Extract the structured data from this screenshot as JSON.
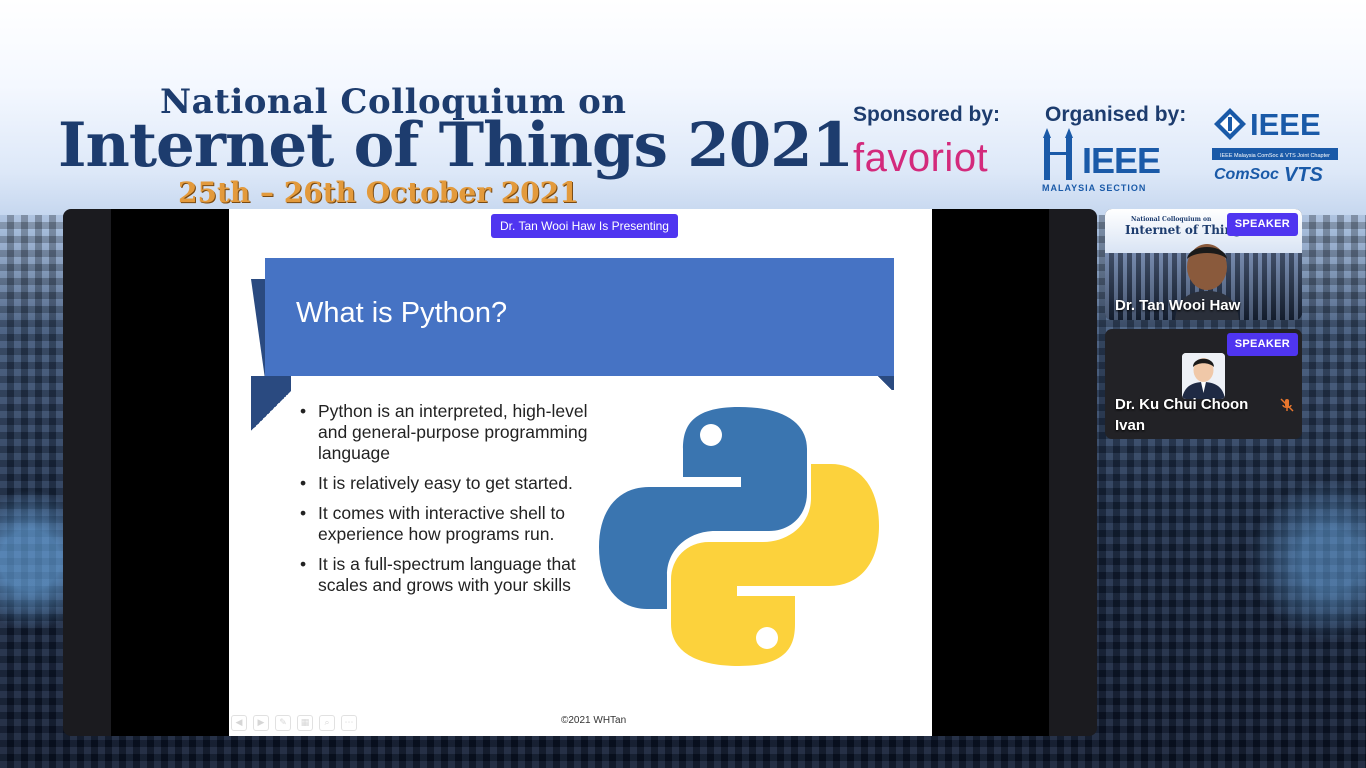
{
  "banner": {
    "title_line1": "National Colloquium on",
    "title_line2": "Internet of Things 2021",
    "dates": "25th – 26th October 2021",
    "sponsored_label": "Sponsored by:",
    "sponsor_logo_text": "favoriot",
    "organised_label": "Organised by:",
    "ieee_malaysia_text": "IEEE",
    "ieee_malaysia_sub": "MALAYSIA SECTION",
    "ieee_text": "IEEE",
    "ieee_chapter": "IEEE Malaysia ComSoc & VTS Joint Chapter",
    "comsoc_text": "ComSoc",
    "vts_text": "VTS"
  },
  "share": {
    "presenting_badge": "Dr. Tan Wooi Haw Is Presenting",
    "slide": {
      "title": "What is Python?",
      "bullets": [
        "Python is an interpreted, high-level and general-purpose programming language",
        "It is relatively easy to get started.",
        "It comes with interactive shell to experience how programs run.",
        "It is a full-spectrum language that scales and grows with your skills"
      ],
      "footer": "©2021 WHTan"
    }
  },
  "participants": [
    {
      "name": "Dr. Tan Wooi Haw",
      "badge": "SPEAKER",
      "mini_banner_1": "National Colloquium on",
      "mini_banner_2": "Internet of Things 2021",
      "muted": false
    },
    {
      "name": "Dr. Ku Chui Choon Ivan",
      "badge": "SPEAKER",
      "muted": true
    }
  ],
  "colors": {
    "accent": "#4f35f0",
    "banner_navy": "#1d3c6e",
    "banner_orange": "#e39a3c",
    "favoriot_pink": "#d32a7c",
    "ieee_blue": "#1a5aa8",
    "slide_header": "#4673c4",
    "python_blue": "#3a75b0",
    "python_yellow": "#fcd23c",
    "mute_orange": "#e8762d"
  },
  "icons": {
    "mute": "microphone-off-icon",
    "python": "python-logo"
  }
}
